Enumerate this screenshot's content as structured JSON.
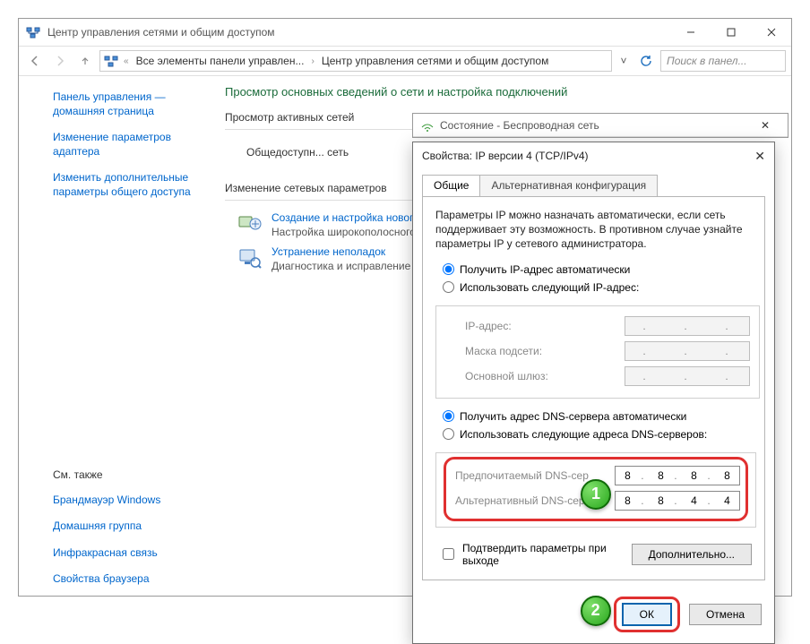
{
  "window": {
    "title": "Центр управления сетями и общим доступом"
  },
  "breadcrumb": {
    "item1": "Все элементы панели управлен...",
    "item2": "Центр управления сетями и общим доступом"
  },
  "search": {
    "placeholder": "Поиск в панел..."
  },
  "sidebar": {
    "home": "Панель управления — домашняя страница",
    "adapter": "Изменение параметров адаптера",
    "sharing": "Изменить дополнительные параметры общего доступа",
    "seealso_title": "См. также",
    "seealso": {
      "firewall": "Брандмауэр Windows",
      "homegroup": "Домашняя группа",
      "infrared": "Инфракрасная связь",
      "browser": "Свойства браузера"
    }
  },
  "main": {
    "heading": "Просмотр основных сведений о сети и настройка подключений",
    "section_active": "Просмотр активных сетей",
    "network_name": "Общедоступн... сеть",
    "section_change": "Изменение сетевых параметров",
    "task1_title": "Создание и настройка нового",
    "task1_desc": "Настройка широкополосного маршрутизатора или точки",
    "task2_title": "Устранение неполадок",
    "task2_desc": "Диагностика и исправление неполадок."
  },
  "status_dialog": {
    "title": "Состояние - Беспроводная сеть"
  },
  "ipv4": {
    "title": "Свойства: IP версии 4 (TCP/IPv4)",
    "tabs": {
      "general": "Общие",
      "alt": "Альтернативная конфигурация"
    },
    "desc": "Параметры IP можно назначать автоматически, если сеть поддерживает эту возможность. В противном случае узнайте параметры IP у сетевого администратора.",
    "ip_auto": "Получить IP-адрес автоматически",
    "ip_manual": "Использовать следующий IP-адрес:",
    "ip_address_lbl": "IP-адрес:",
    "mask_lbl": "Маска подсети:",
    "gateway_lbl": "Основной шлюз:",
    "dns_auto": "Получить адрес DNS-сервера автоматически",
    "dns_manual": "Использовать следующие адреса DNS-серверов:",
    "dns_pref_lbl": "Предпочитаемый DNS-сер",
    "dns_alt_lbl": "Альтернативный DNS-сер",
    "dns_pref": {
      "o1": "8",
      "o2": "8",
      "o3": "8",
      "o4": "8"
    },
    "dns_altv": {
      "o1": "8",
      "o2": "8",
      "o3": "4",
      "o4": "4"
    },
    "confirm": "Подтвердить параметры при выходе",
    "advanced": "Дополнительно...",
    "ok": "ОК",
    "cancel": "Отмена"
  },
  "markers": {
    "one": "1",
    "two": "2"
  }
}
